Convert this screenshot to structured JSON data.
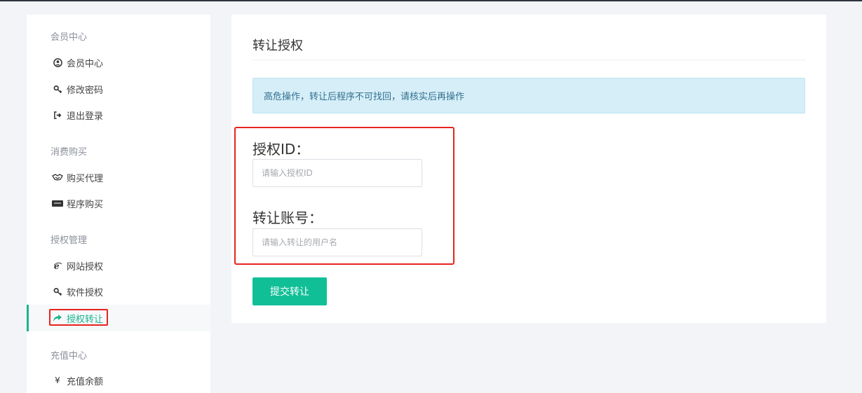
{
  "sidebar": {
    "sections": [
      {
        "title": "会员中心",
        "items": [
          {
            "label": "会员中心",
            "icon": "user-circle-icon"
          },
          {
            "label": "修改密码",
            "icon": "key-icon"
          },
          {
            "label": "退出登录",
            "icon": "sign-out-icon"
          }
        ]
      },
      {
        "title": "消费购买",
        "items": [
          {
            "label": "购买代理",
            "icon": "handshake-icon"
          },
          {
            "label": "程序购买",
            "icon": "paypal-icon"
          }
        ]
      },
      {
        "title": "授权管理",
        "items": [
          {
            "label": "网站授权",
            "icon": "ie-icon"
          },
          {
            "label": "软件授权",
            "icon": "key-icon"
          },
          {
            "label": "授权转让",
            "icon": "share-arrow-icon",
            "active": true
          }
        ]
      },
      {
        "title": "充值中心",
        "items": [
          {
            "label": "充值余额",
            "icon": "yen-icon"
          }
        ]
      }
    ]
  },
  "main": {
    "title": "转让授权",
    "alert": "高危操作，转让后程序不可找回，请核实后再操作",
    "fields": [
      {
        "label": "授权ID：",
        "placeholder": "请输入授权ID",
        "value": ""
      },
      {
        "label": "转让账号：",
        "placeholder": "请输入转让的用户名",
        "value": ""
      }
    ],
    "submit_label": "提交转让"
  },
  "colors": {
    "accent": "#19b58c",
    "button": "#11bf97",
    "highlight": "#e8231e",
    "alert_bg": "#d6eef8",
    "alert_text": "#31708f"
  }
}
